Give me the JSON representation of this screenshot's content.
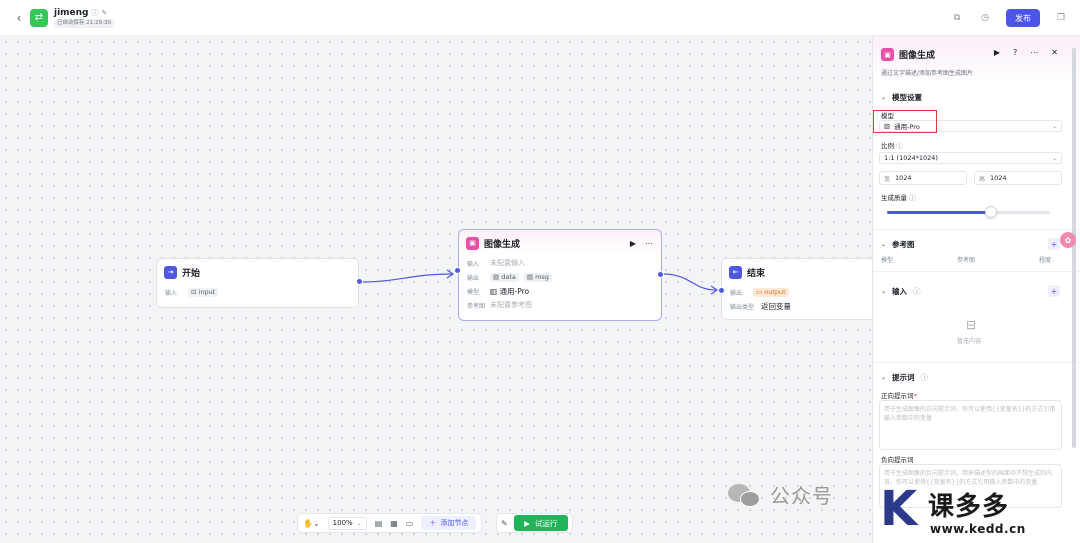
{
  "header": {
    "back_icon": "chevron-left-icon",
    "app_name": "jimeng",
    "autosave": "已自动保存 21:29:30",
    "publish_label": "发布"
  },
  "nodes": {
    "start": {
      "title": "开始",
      "input_label": "输入",
      "input_var": "input"
    },
    "image": {
      "title": "图像生成",
      "input_label": "输入",
      "input_value": "未配置输入",
      "output_label": "输出",
      "output_data": "data",
      "output_msg": "msg",
      "model_label": "模型",
      "model_value": "通用-Pro",
      "ref_label": "参考图",
      "ref_value": "未配置参考图"
    },
    "end": {
      "title": "结束",
      "output_label": "输出",
      "output_var": "output",
      "type_label": "输出类型",
      "type_value": "返回变量"
    }
  },
  "toolbar": {
    "zoom": "100%",
    "add_node": "添加节点",
    "run": "试运行"
  },
  "panel": {
    "title": "图像生成",
    "desc": "通过文字描述/添加参考图生成图片",
    "model_section": "模型设置",
    "model_label": "模型",
    "model_value": "通用-Pro",
    "ratio_label": "比例",
    "ratio_value": "1:1 (1024*1024)",
    "width_tag": "宽",
    "width_value": "1024",
    "height_tag": "高",
    "height_value": "1024",
    "quality_label": "生成质量",
    "quality_level": 0.64,
    "ref_section": "参考图",
    "ref_cols": [
      "模型",
      "参考图",
      "程度"
    ],
    "input_section": "输入",
    "input_empty": "暂无内容",
    "prompt_section": "提示词",
    "pos_label": "正向提示词",
    "pos_placeholder": "用于生成图像的正向提示词，你可以使用{{变量名}}的方式引用输入参数中的变量",
    "neg_label": "负向提示词",
    "neg_placeholder": "用于生成图像的负向提示词，用来描述你的画面中不想生成的内容，你可以使用{{变量名}}的方式引用输入参数中的变量"
  },
  "watermark": {
    "wechat_text": "公众号",
    "brand_name": "课多多",
    "brand_url": "www.kedd.cn"
  },
  "colors": {
    "accent": "#4c55e8",
    "run_green": "#21b45a",
    "highlight_red": "#e23a3a",
    "image_node_pink": "#e94fa6"
  }
}
